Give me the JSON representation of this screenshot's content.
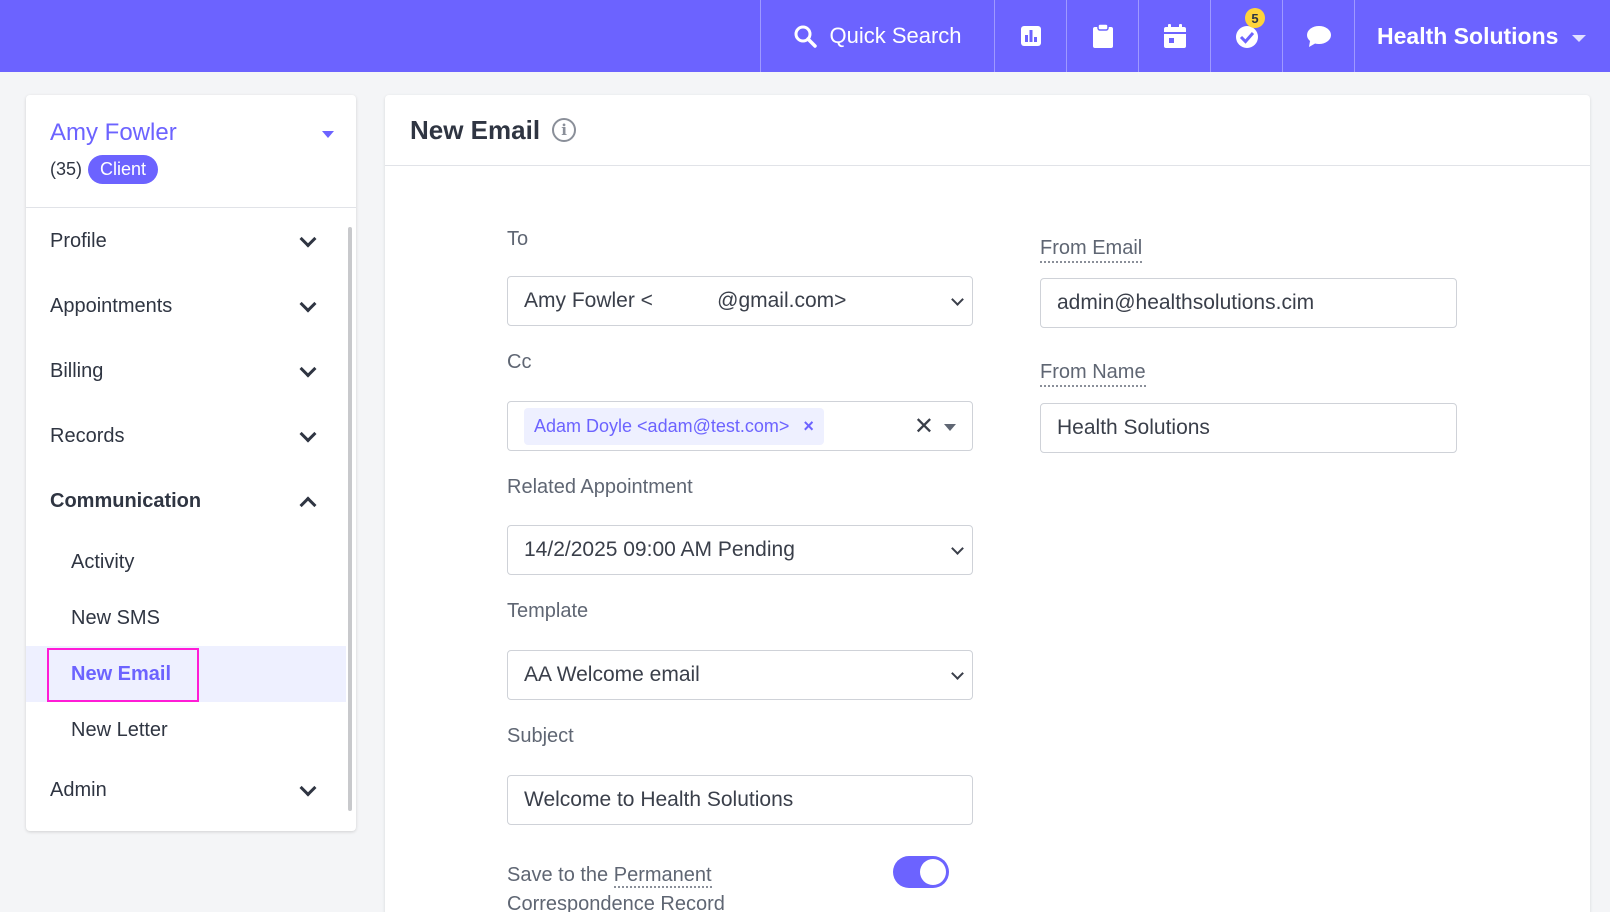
{
  "topbar": {
    "search_label": "Quick Search",
    "badge_count": "5",
    "org_name": "Health Solutions",
    "icons": [
      "search-icon",
      "chart-icon",
      "clipboard-icon",
      "calendar-icon",
      "check-circle-icon",
      "chat-icon",
      "caret-down-icon"
    ]
  },
  "client": {
    "name": "Amy Fowler",
    "age": "(35)",
    "type": "Client"
  },
  "sidebar": {
    "items": [
      {
        "label": "Profile"
      },
      {
        "label": "Appointments"
      },
      {
        "label": "Billing"
      },
      {
        "label": "Records"
      },
      {
        "label": "Communication"
      },
      {
        "label": "Admin"
      }
    ],
    "communication_sub": [
      {
        "label": "Activity"
      },
      {
        "label": "New SMS"
      },
      {
        "label": "New Email"
      },
      {
        "label": "New Letter"
      }
    ]
  },
  "main": {
    "title": "New Email",
    "to_label": "To",
    "to_value": "Amy Fowler <           @gmail.com>",
    "cc_label": "Cc",
    "cc_tag": "Adam Doyle <adam@test.com>",
    "cc_tag_remove": "×",
    "cc_clear": "✕",
    "related_label": "Related Appointment",
    "related_value": "14/2/2025 09:00 AM Pending",
    "template_label": "Template",
    "template_value": "AA Welcome email",
    "subject_label": "Subject",
    "subject_value": "Welcome to Health Solutions",
    "save_label_prefix": "Save to the",
    "save_label_link": "Permanent",
    "save_label_line2": "Correspondence Record",
    "save_toggle_on": true,
    "from_email_label": "From Email",
    "from_email_value": "admin@healthsolutions.cim",
    "from_name_label": "From Name",
    "from_name_value": "Health Solutions"
  },
  "colors": {
    "brand": "#6c63ff",
    "badge": "#ffd43b",
    "highlight_outline": "#ff1cd6"
  }
}
